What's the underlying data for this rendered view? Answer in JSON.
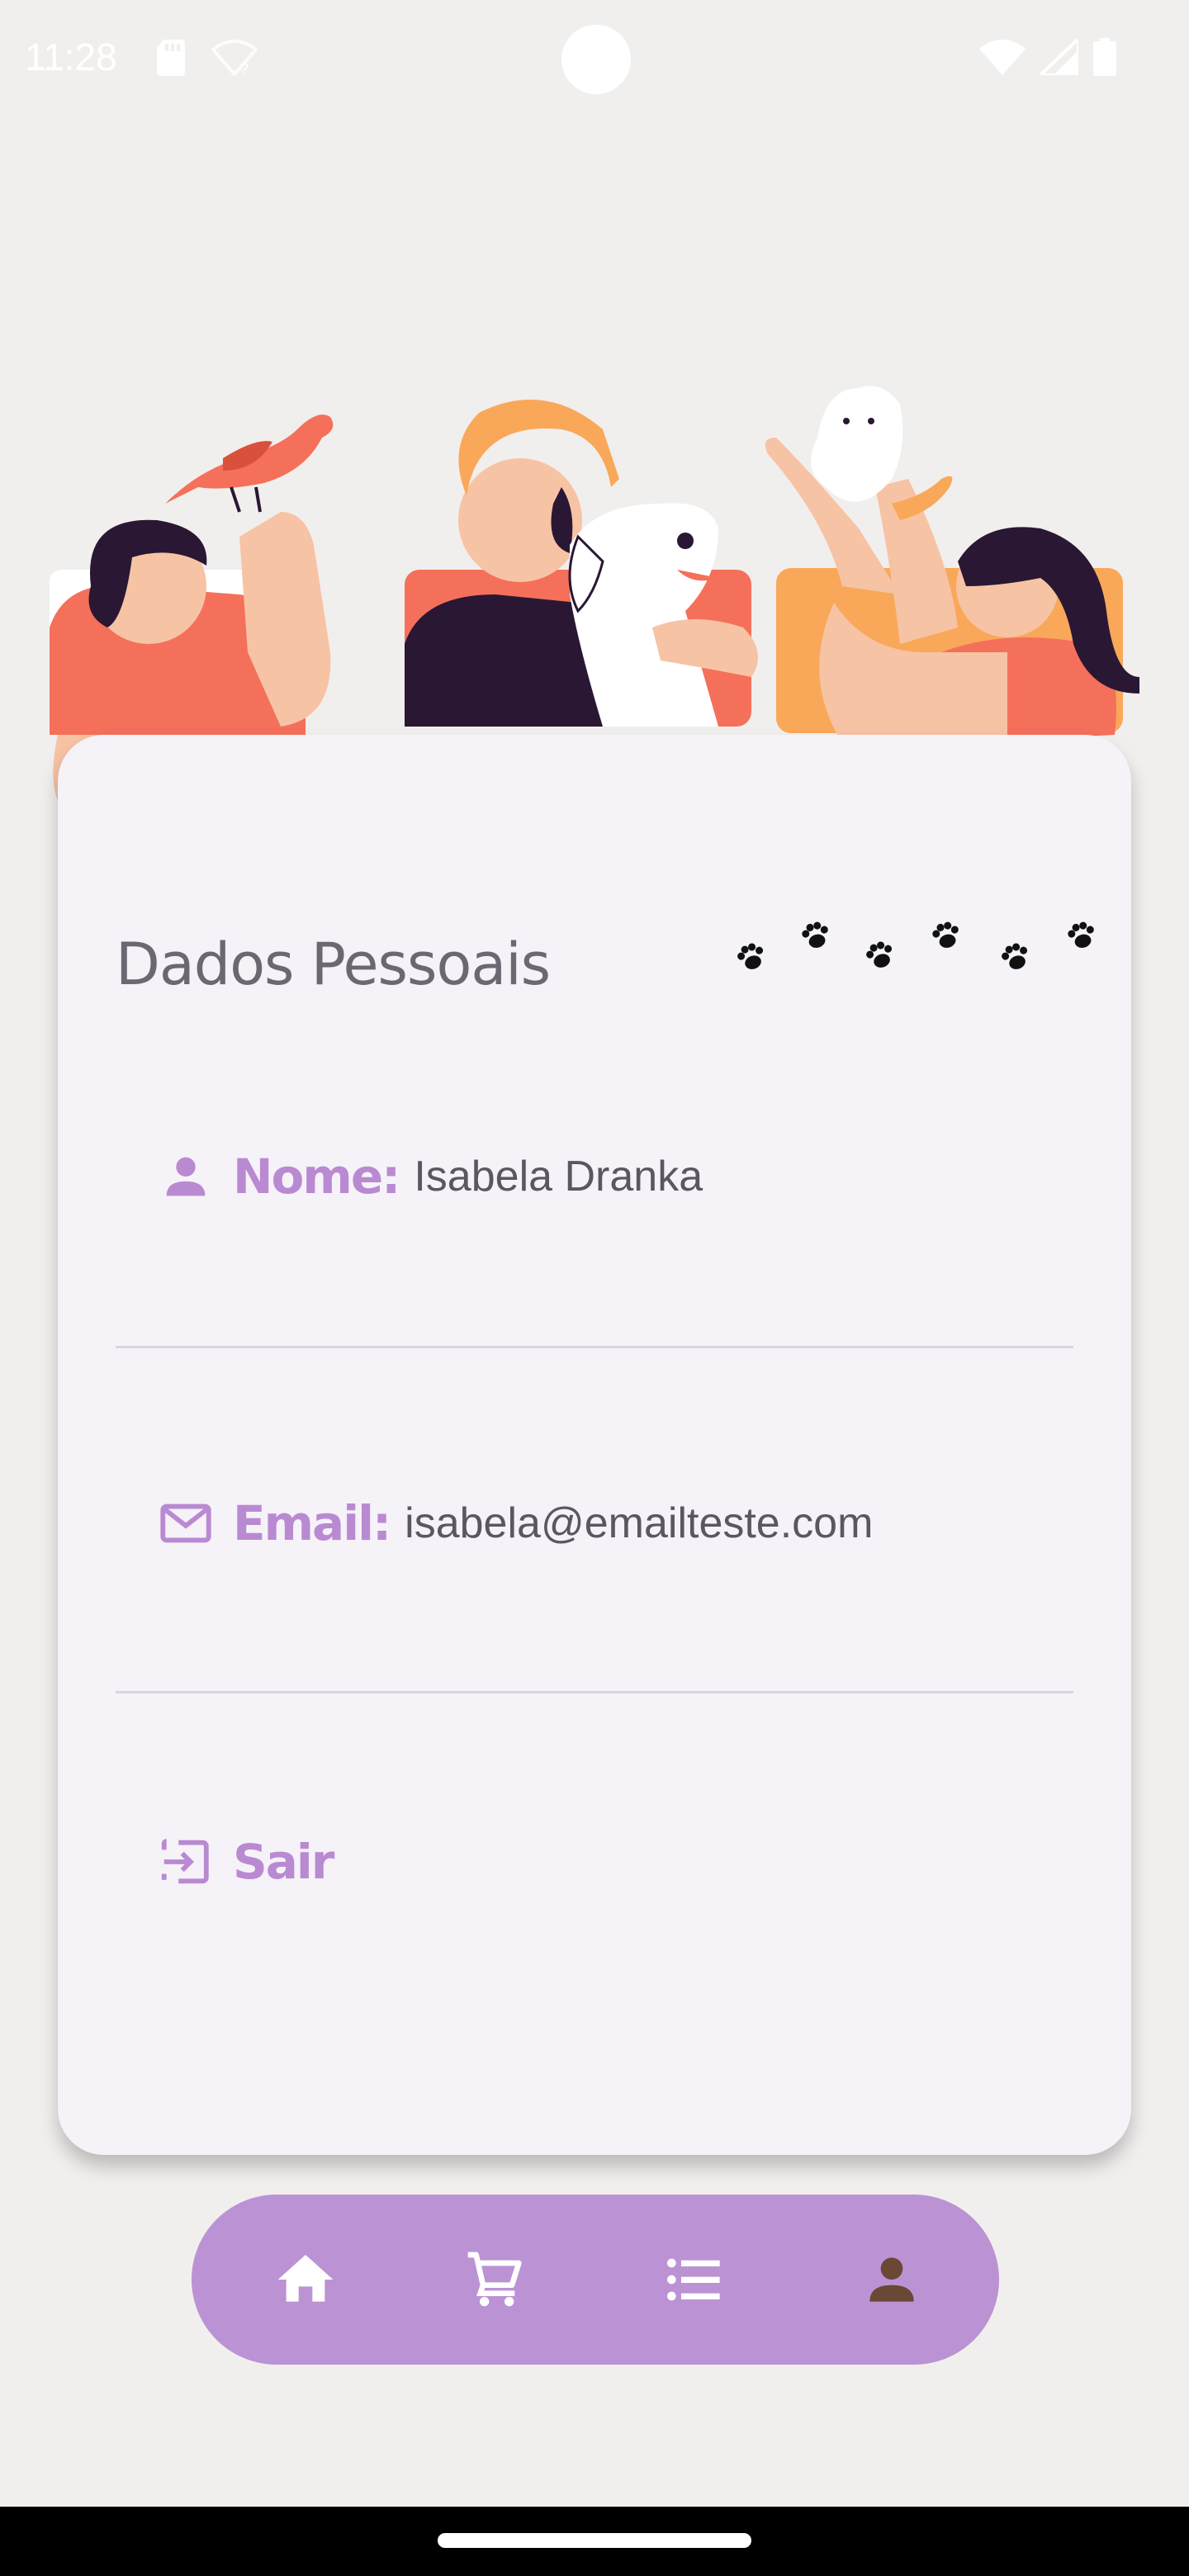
{
  "status_bar": {
    "time": "11:28",
    "icons": [
      "sd-card-icon",
      "wifi-question-icon",
      "wifi-icon",
      "signal-icon",
      "battery-icon"
    ]
  },
  "illustration": {
    "description_icons": [
      "bird-icon",
      "dog-icon",
      "cat-icon"
    ]
  },
  "card": {
    "title": "Dados Pessoais",
    "name": {
      "label": "Nome:",
      "value": "Isabela Dranka",
      "icon": "person-icon"
    },
    "email": {
      "label": "Email:",
      "value": "isabela@emailteste.com",
      "icon": "mail-icon"
    },
    "logout": {
      "label": "Sair",
      "icon": "logout-icon"
    }
  },
  "bottom_nav": {
    "items": [
      {
        "name": "home",
        "icon": "home-icon"
      },
      {
        "name": "cart",
        "icon": "cart-icon"
      },
      {
        "name": "list",
        "icon": "list-icon"
      },
      {
        "name": "profile",
        "icon": "person-icon",
        "active": true
      }
    ]
  },
  "colors": {
    "background": "#f1efed",
    "card": "#f5f2f8",
    "accent": "#b98ad2",
    "nav_bg": "#bb93d4",
    "active_icon": "#6b4736",
    "coral": "#f5705a",
    "orange": "#f9a85a",
    "dark": "#2a1733"
  }
}
